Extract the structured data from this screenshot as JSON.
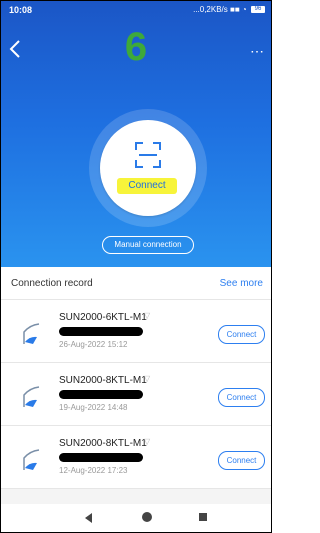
{
  "status_bar": {
    "time": "10:08",
    "network_speed": "...0,2KB/s",
    "battery": "96"
  },
  "header": {
    "step_number": "6"
  },
  "scan": {
    "connect_label": "Connect",
    "manual_label": "Manual connection"
  },
  "records": {
    "title": "Connection record",
    "see_more": "See more",
    "items": [
      {
        "name": "SUN2000-6KTL-M1",
        "date": "26-Aug-2022 15:12",
        "button": "Connect"
      },
      {
        "name": "SUN2000-8KTL-M1",
        "date": "19-Aug-2022 14:48",
        "button": "Connect"
      },
      {
        "name": "SUN2000-8KTL-M1",
        "date": "12-Aug-2022 17:23",
        "button": "Connect"
      }
    ]
  },
  "colors": {
    "primary_blue": "#1e6fe0",
    "highlight_yellow": "#f7f43a",
    "step_green": "#3ea93a"
  },
  "icons": {
    "back": "chevron-left-icon",
    "more": "more-dots-icon",
    "scan": "scan-frame-icon",
    "device": "inverter-device-icon",
    "wifi": "wifi-icon"
  }
}
